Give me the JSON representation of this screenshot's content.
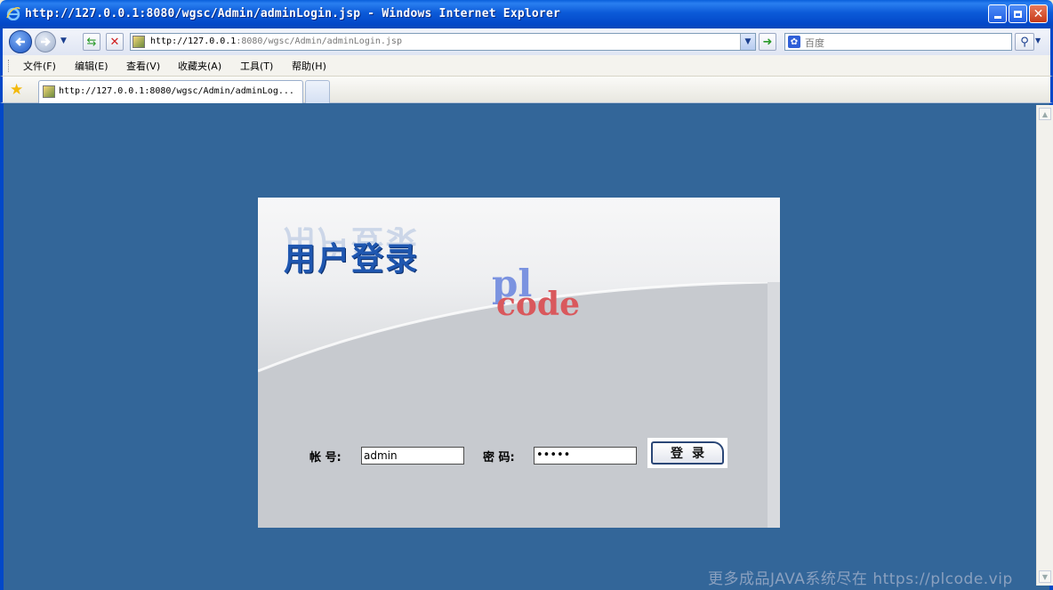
{
  "window": {
    "title": "http://127.0.0.1:8080/wgsc/Admin/adminLogin.jsp - Windows Internet Explorer"
  },
  "navbar": {
    "url_host": "http://127.0.0.1",
    "url_path": ":8080/wgsc/Admin/adminLogin.jsp",
    "search_placeholder": "百度"
  },
  "menu": {
    "items": [
      {
        "label": "文件(F)"
      },
      {
        "label": "编辑(E)"
      },
      {
        "label": "查看(V)"
      },
      {
        "label": "收藏夹(A)"
      },
      {
        "label": "工具(T)"
      },
      {
        "label": "帮助(H)"
      }
    ]
  },
  "tabs": [
    {
      "label": "http://127.0.0.1:8080/wgsc/Admin/adminLog..."
    }
  ],
  "login": {
    "heading": "用户登录",
    "watermark_top": "pl",
    "watermark_bottom": "code",
    "account_label": "帐 号:",
    "account_value": "admin",
    "password_label": "密 码:",
    "password_value": "•••••",
    "submit_label": "登录"
  },
  "footer_watermark": "更多成品JAVA系统尽在 https://plcode.vip",
  "colors": {
    "page_background": "#336699",
    "title_bar": "#0348c8",
    "heading": "#1f57b0"
  }
}
